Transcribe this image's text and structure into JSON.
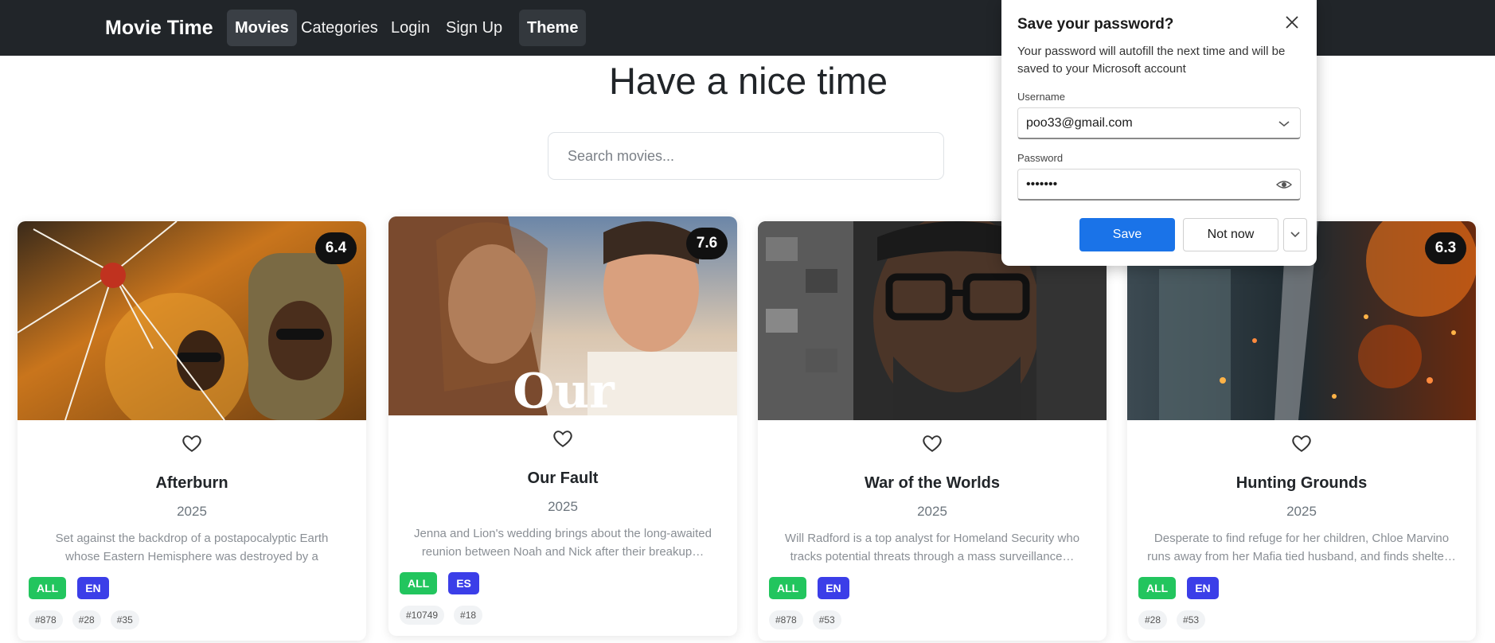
{
  "navbar": {
    "brand": "Movie Time",
    "links": [
      "Movies",
      "Categories",
      "Login",
      "Sign Up"
    ],
    "theme": "Theme"
  },
  "hero": {
    "title": "Have a nice time",
    "search_placeholder": "Search movies..."
  },
  "movies": [
    {
      "rating": "6.4",
      "title": "Afterburn",
      "year": "2025",
      "description": "Set against the backdrop of a postapocalyptic Earth whose Eastern Hemisphere was destroyed by a massive…",
      "badges": [
        "ALL",
        "EN"
      ],
      "tags": [
        "#878",
        "#28",
        "#35"
      ]
    },
    {
      "rating": "7.6",
      "title": "Our Fault",
      "year": "2025",
      "description": "Jenna and Lion's wedding brings about the long-awaited reunion between Noah and Nick after their breakup…",
      "badges": [
        "ALL",
        "ES"
      ],
      "tags": [
        "#10749",
        "#18"
      ],
      "poster_text": "Our"
    },
    {
      "rating": "",
      "title": "War of the Worlds",
      "year": "2025",
      "description": "Will Radford is a top analyst for Homeland Security who tracks potential threats through a mass surveillance…",
      "badges": [
        "ALL",
        "EN"
      ],
      "tags": [
        "#878",
        "#53"
      ]
    },
    {
      "rating": "6.3",
      "title": "Hunting Grounds",
      "year": "2025",
      "description": "Desperate to find refuge for her children, Chloe Marvino runs away from her Mafia tied husband, and finds shelte…",
      "badges": [
        "ALL",
        "EN"
      ],
      "tags": [
        "#28",
        "#53"
      ]
    }
  ],
  "password_popup": {
    "title": "Save your password?",
    "description": "Your password will autofill the next time and will be saved to your Microsoft account",
    "username_label": "Username",
    "username_value": "poo33@gmail.com",
    "password_label": "Password",
    "password_value": "•••••••",
    "save_label": "Save",
    "not_now_label": "Not now"
  },
  "colors": {
    "navbar_bg": "#212529",
    "badge_all": "#22c55e",
    "badge_lang": "#3b3ee8",
    "save_button": "#1a73e8"
  },
  "icons": [
    "heart-icon",
    "close-icon",
    "chevron-down-icon",
    "eye-icon"
  ]
}
